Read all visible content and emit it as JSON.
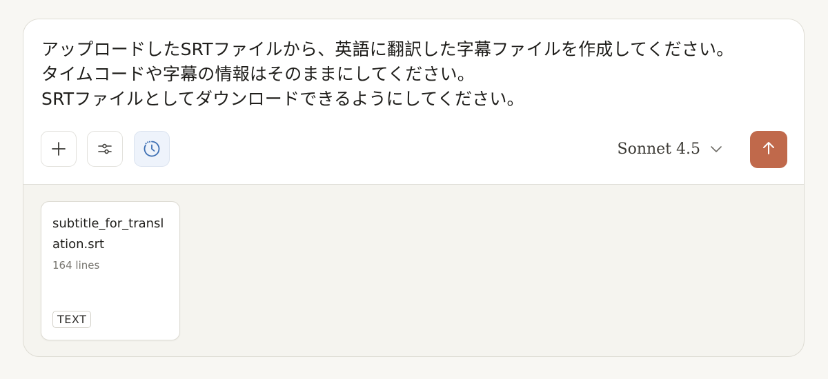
{
  "prompt": {
    "text": "アップロードしたSRTファイルから、英語に翻訳した字幕ファイルを作成してください。\nタイムコードや字幕の情報はそのままにしてください。\nSRTファイルとしてダウンロードできるようにしてください。"
  },
  "toolbar": {
    "buttons": [
      {
        "name": "add-button",
        "icon": "plus-icon"
      },
      {
        "name": "settings-button",
        "icon": "sliders-icon"
      },
      {
        "name": "history-button",
        "icon": "clock-icon",
        "active": true
      }
    ]
  },
  "model": {
    "name": "Sonnet 4.5",
    "icon": "chevron-down-icon"
  },
  "send": {
    "icon": "arrow-up-icon",
    "color": "#c0694b"
  },
  "attachment": {
    "filename": "subtitle_for_translation.srt",
    "meta": "164 lines",
    "type": "TEXT"
  },
  "colors": {
    "background": "#f8f7f3",
    "accent": "#c0694b",
    "active_tool_bg": "#eef3fb",
    "active_tool_icon": "#3d6fb3"
  }
}
